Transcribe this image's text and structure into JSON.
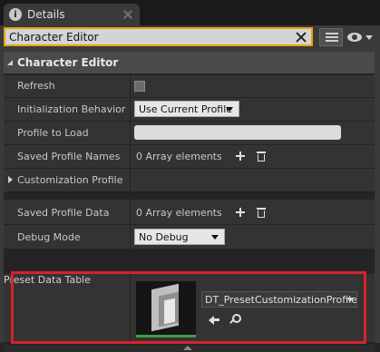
{
  "tab": {
    "label": "Details",
    "icon": "info-icon"
  },
  "search": {
    "value": "Character Editor"
  },
  "toolbar": {
    "grid_icon": "property-matrix-icon",
    "view_icon": "eye-icon"
  },
  "category": {
    "label": "Character Editor"
  },
  "rows": {
    "refresh": {
      "label": "Refresh"
    },
    "init_behavior": {
      "label": "Initialization Behavior",
      "value": "Use Current Profile"
    },
    "profile_to_load": {
      "label": "Profile to Load",
      "value": ""
    },
    "saved_profile_names": {
      "label": "Saved Profile Names",
      "value": "0 Array elements"
    },
    "customization_profile": {
      "label": "Customization Profile"
    },
    "saved_profile_data": {
      "label": "Saved Profile Data",
      "value": "0 Array elements"
    },
    "debug_mode": {
      "label": "Debug Mode",
      "value": "No Debug"
    },
    "preset_data_table": {
      "label": "Preset Data Table",
      "value": "DT_PresetCustomizationProfile"
    }
  },
  "colors": {
    "highlight": "#e8a30c",
    "annotation": "#d6232a",
    "thumb_accent": "#3f9f3f"
  }
}
